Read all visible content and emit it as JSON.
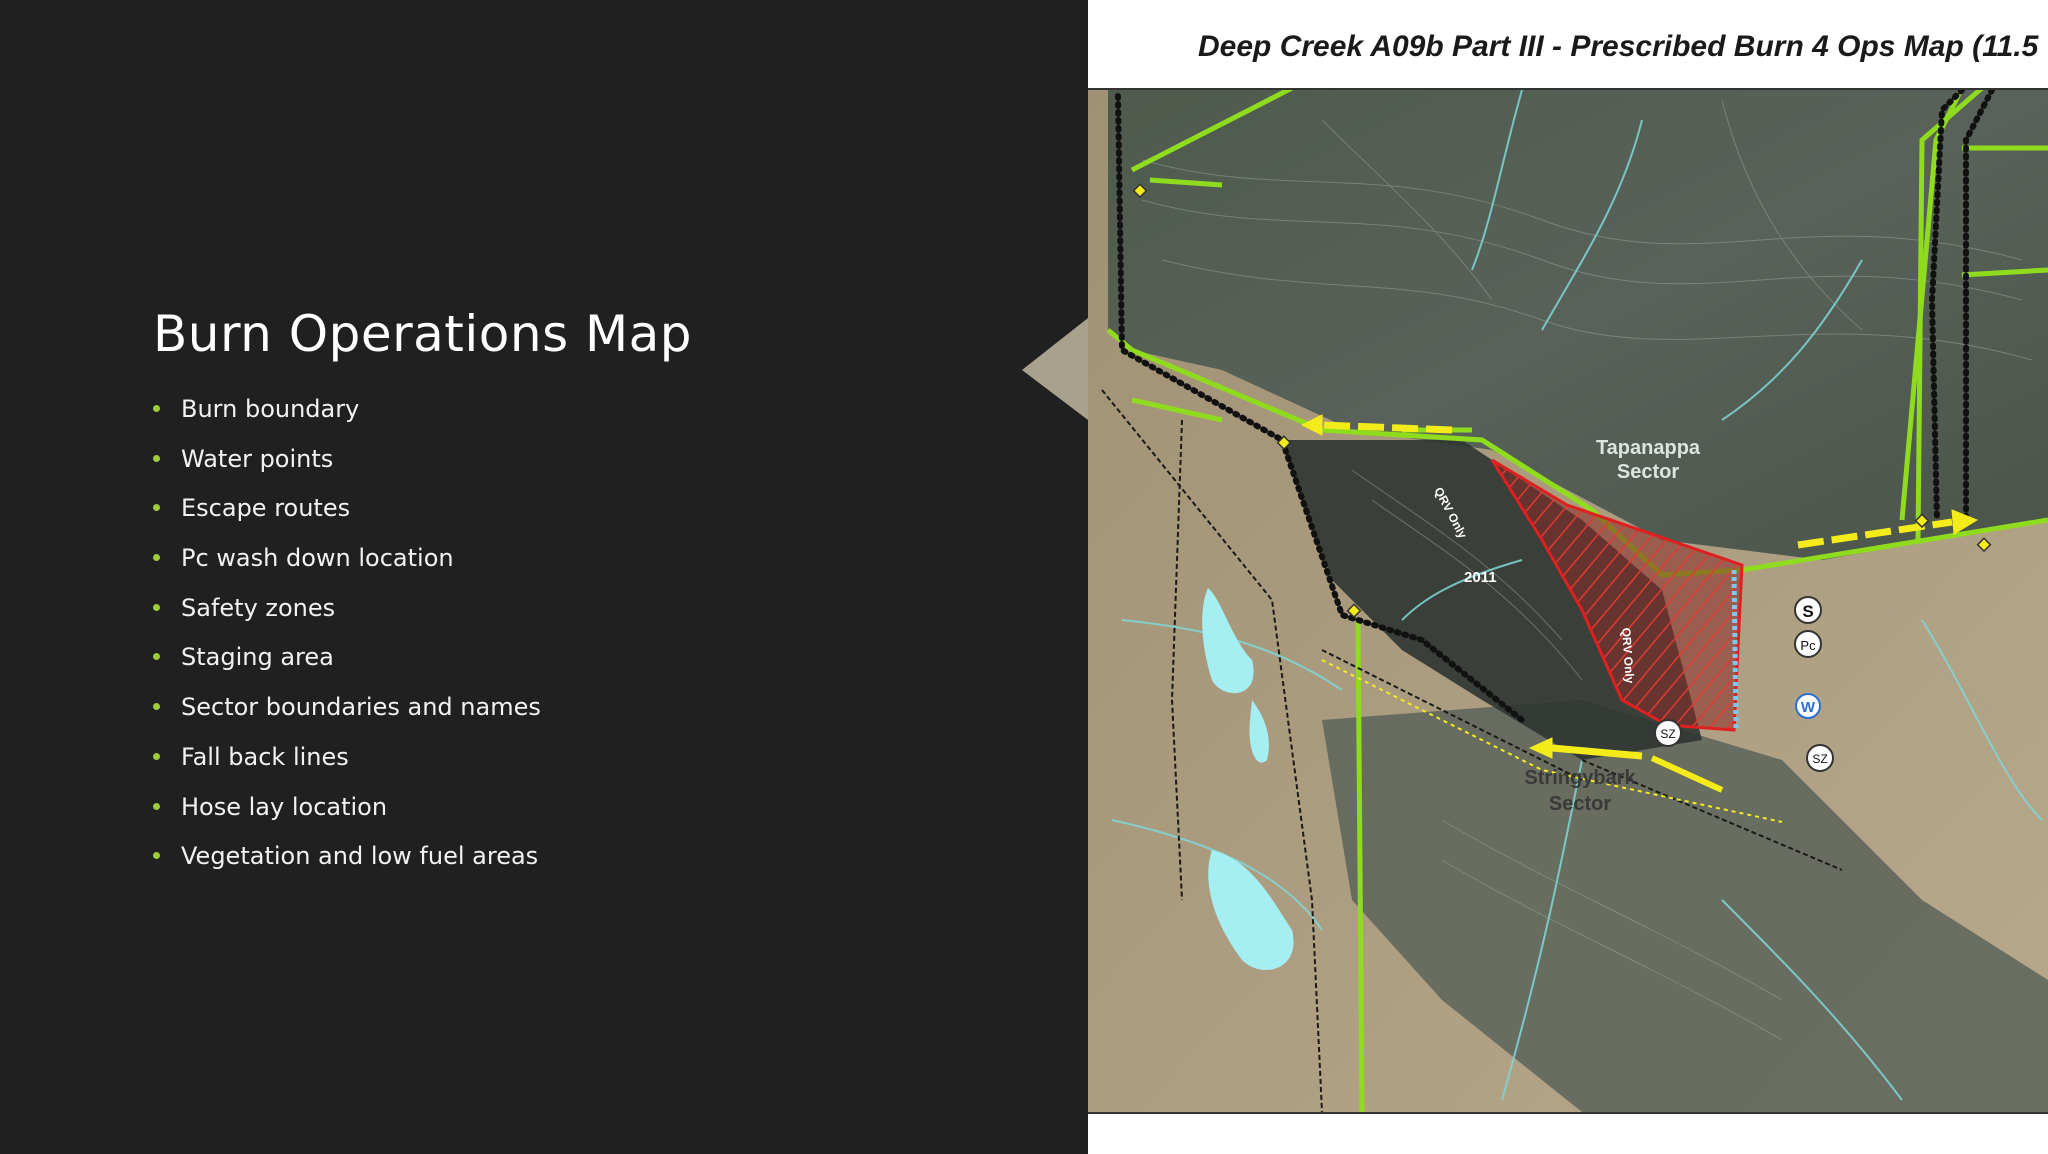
{
  "slide": {
    "title": "Burn Operations Map",
    "bullets": [
      "Burn boundary",
      "Water points",
      "Escape routes",
      "Pc wash down location",
      "Safety zones",
      "Staging area",
      "Sector boundaries and names",
      "Fall back lines",
      "Hose lay location",
      "Vegetation and low fuel areas"
    ]
  },
  "map": {
    "title": "Deep Creek A09b Part III - Prescribed Burn 4 Ops Map (11.5",
    "sectors": [
      "Tapanappa\nSector",
      "Stringybark\nSector"
    ],
    "sector_a_line1": "Tapanappa",
    "sector_a_line2": "Sector",
    "sector_b_line1": "Stringybark",
    "sector_b_line2": "Sector",
    "year_label": "2011",
    "track_label_1": "QRV Only",
    "track_label_2": "QRV Only",
    "markers": {
      "staging": "S",
      "washdown": "Pc",
      "water": "W",
      "safety_zone_1": "SZ",
      "safety_zone_2": "SZ"
    }
  },
  "colors": {
    "background": "#202021",
    "bullet_accent": "#9ccc3b",
    "boundary_green": "#8fdc1e",
    "escape_yellow": "#f4ec1a",
    "burn_red": "#d81f1f",
    "water_blue": "#a5eef2"
  }
}
